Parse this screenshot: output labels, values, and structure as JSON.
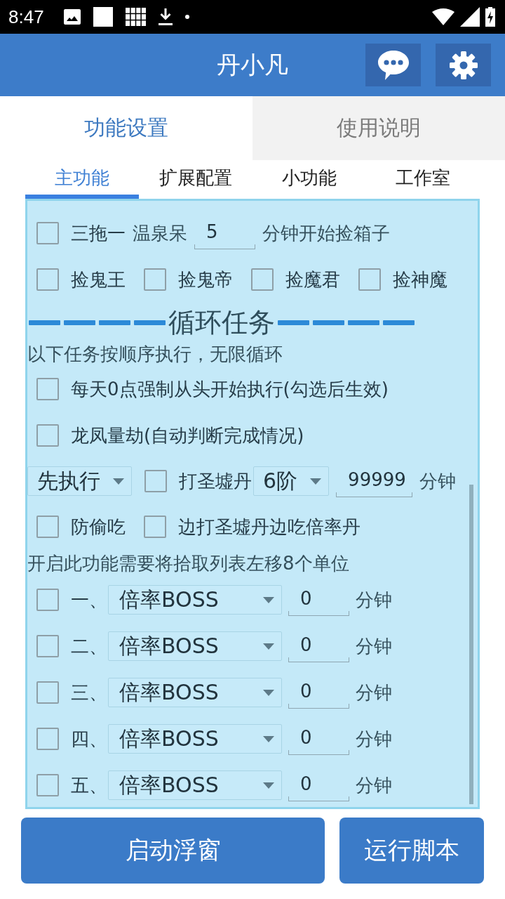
{
  "status_bar": {
    "time": "8:47"
  },
  "app_bar": {
    "title": "丹小凡"
  },
  "main_tabs": [
    {
      "label": "功能设置",
      "selected": true
    },
    {
      "label": "使用说明",
      "selected": false
    }
  ],
  "sub_tabs": [
    {
      "label": "主功能",
      "selected": true
    },
    {
      "label": "扩展配置",
      "selected": false
    },
    {
      "label": "小功能",
      "selected": false
    },
    {
      "label": "工作室",
      "selected": false
    }
  ],
  "panel": {
    "rows": [
      {
        "kind": "options",
        "items": [
          {
            "kind": "checkbox",
            "label": "三拖一",
            "checked": false
          },
          {
            "kind": "text",
            "label": "温泉呆"
          },
          {
            "kind": "input",
            "value": "5"
          },
          {
            "kind": "text",
            "label": "分钟开始捡箱子"
          }
        ]
      },
      {
        "kind": "options",
        "items": [
          {
            "kind": "checkbox",
            "label": "捡鬼王",
            "checked": false
          },
          {
            "kind": "checkbox",
            "label": "捡鬼帝",
            "checked": false
          },
          {
            "kind": "checkbox",
            "label": "捡魔君",
            "checked": false
          },
          {
            "kind": "checkbox",
            "label": "捡神魔",
            "checked": false
          }
        ]
      },
      {
        "kind": "heading",
        "text": "循环任务"
      },
      {
        "kind": "note",
        "text": "以下任务按顺序执行，无限循环"
      },
      {
        "kind": "options",
        "items": [
          {
            "kind": "checkbox",
            "label": "每天0点强制从头开始执行(勾选后生效)",
            "checked": false
          }
        ]
      },
      {
        "kind": "options",
        "items": [
          {
            "kind": "checkbox",
            "label": "龙凤量劫(自动判断完成情况)",
            "checked": false
          }
        ]
      },
      {
        "kind": "options",
        "items": [
          {
            "kind": "dropdown",
            "value": "先执行"
          },
          {
            "kind": "checkbox",
            "label": "打圣墟丹",
            "checked": false
          },
          {
            "kind": "dropdown",
            "value": "6阶"
          },
          {
            "kind": "input",
            "value": "99999"
          },
          {
            "kind": "text",
            "label": "分钟"
          }
        ]
      },
      {
        "kind": "options",
        "items": [
          {
            "kind": "checkbox",
            "label": "防偷吃",
            "checked": false
          },
          {
            "kind": "checkbox",
            "label": "边打圣墟丹边吃倍率丹",
            "checked": false
          }
        ]
      },
      {
        "kind": "note",
        "text": "开启此功能需要将拾取列表左移8个单位"
      },
      {
        "kind": "timer",
        "items": [
          {
            "kind": "checkbox",
            "label": "一、",
            "checked": false
          },
          {
            "kind": "dropdown",
            "value": "倍率BOSS"
          },
          {
            "kind": "input",
            "value": "0"
          },
          {
            "kind": "text",
            "label": "分钟"
          }
        ]
      },
      {
        "kind": "timer",
        "items": [
          {
            "kind": "checkbox",
            "label": "二、",
            "checked": false
          },
          {
            "kind": "dropdown",
            "value": "倍率BOSS"
          },
          {
            "kind": "input",
            "value": "0"
          },
          {
            "kind": "text",
            "label": "分钟"
          }
        ]
      },
      {
        "kind": "timer",
        "items": [
          {
            "kind": "checkbox",
            "label": "三、",
            "checked": false
          },
          {
            "kind": "dropdown",
            "value": "倍率BOSS"
          },
          {
            "kind": "input",
            "value": "0"
          },
          {
            "kind": "text",
            "label": "分钟"
          }
        ]
      },
      {
        "kind": "timer",
        "items": [
          {
            "kind": "checkbox",
            "label": "四、",
            "checked": false
          },
          {
            "kind": "dropdown",
            "value": "倍率BOSS"
          },
          {
            "kind": "input",
            "value": "0"
          },
          {
            "kind": "text",
            "label": "分钟"
          }
        ]
      },
      {
        "kind": "timer",
        "items": [
          {
            "kind": "checkbox",
            "label": "五、",
            "checked": false
          },
          {
            "kind": "dropdown",
            "value": "倍率BOSS"
          },
          {
            "kind": "input",
            "value": "0"
          },
          {
            "kind": "text",
            "label": "分钟"
          }
        ]
      }
    ]
  },
  "buttons": [
    {
      "label": "启动浮窗"
    },
    {
      "label": "运行脚本"
    }
  ]
}
